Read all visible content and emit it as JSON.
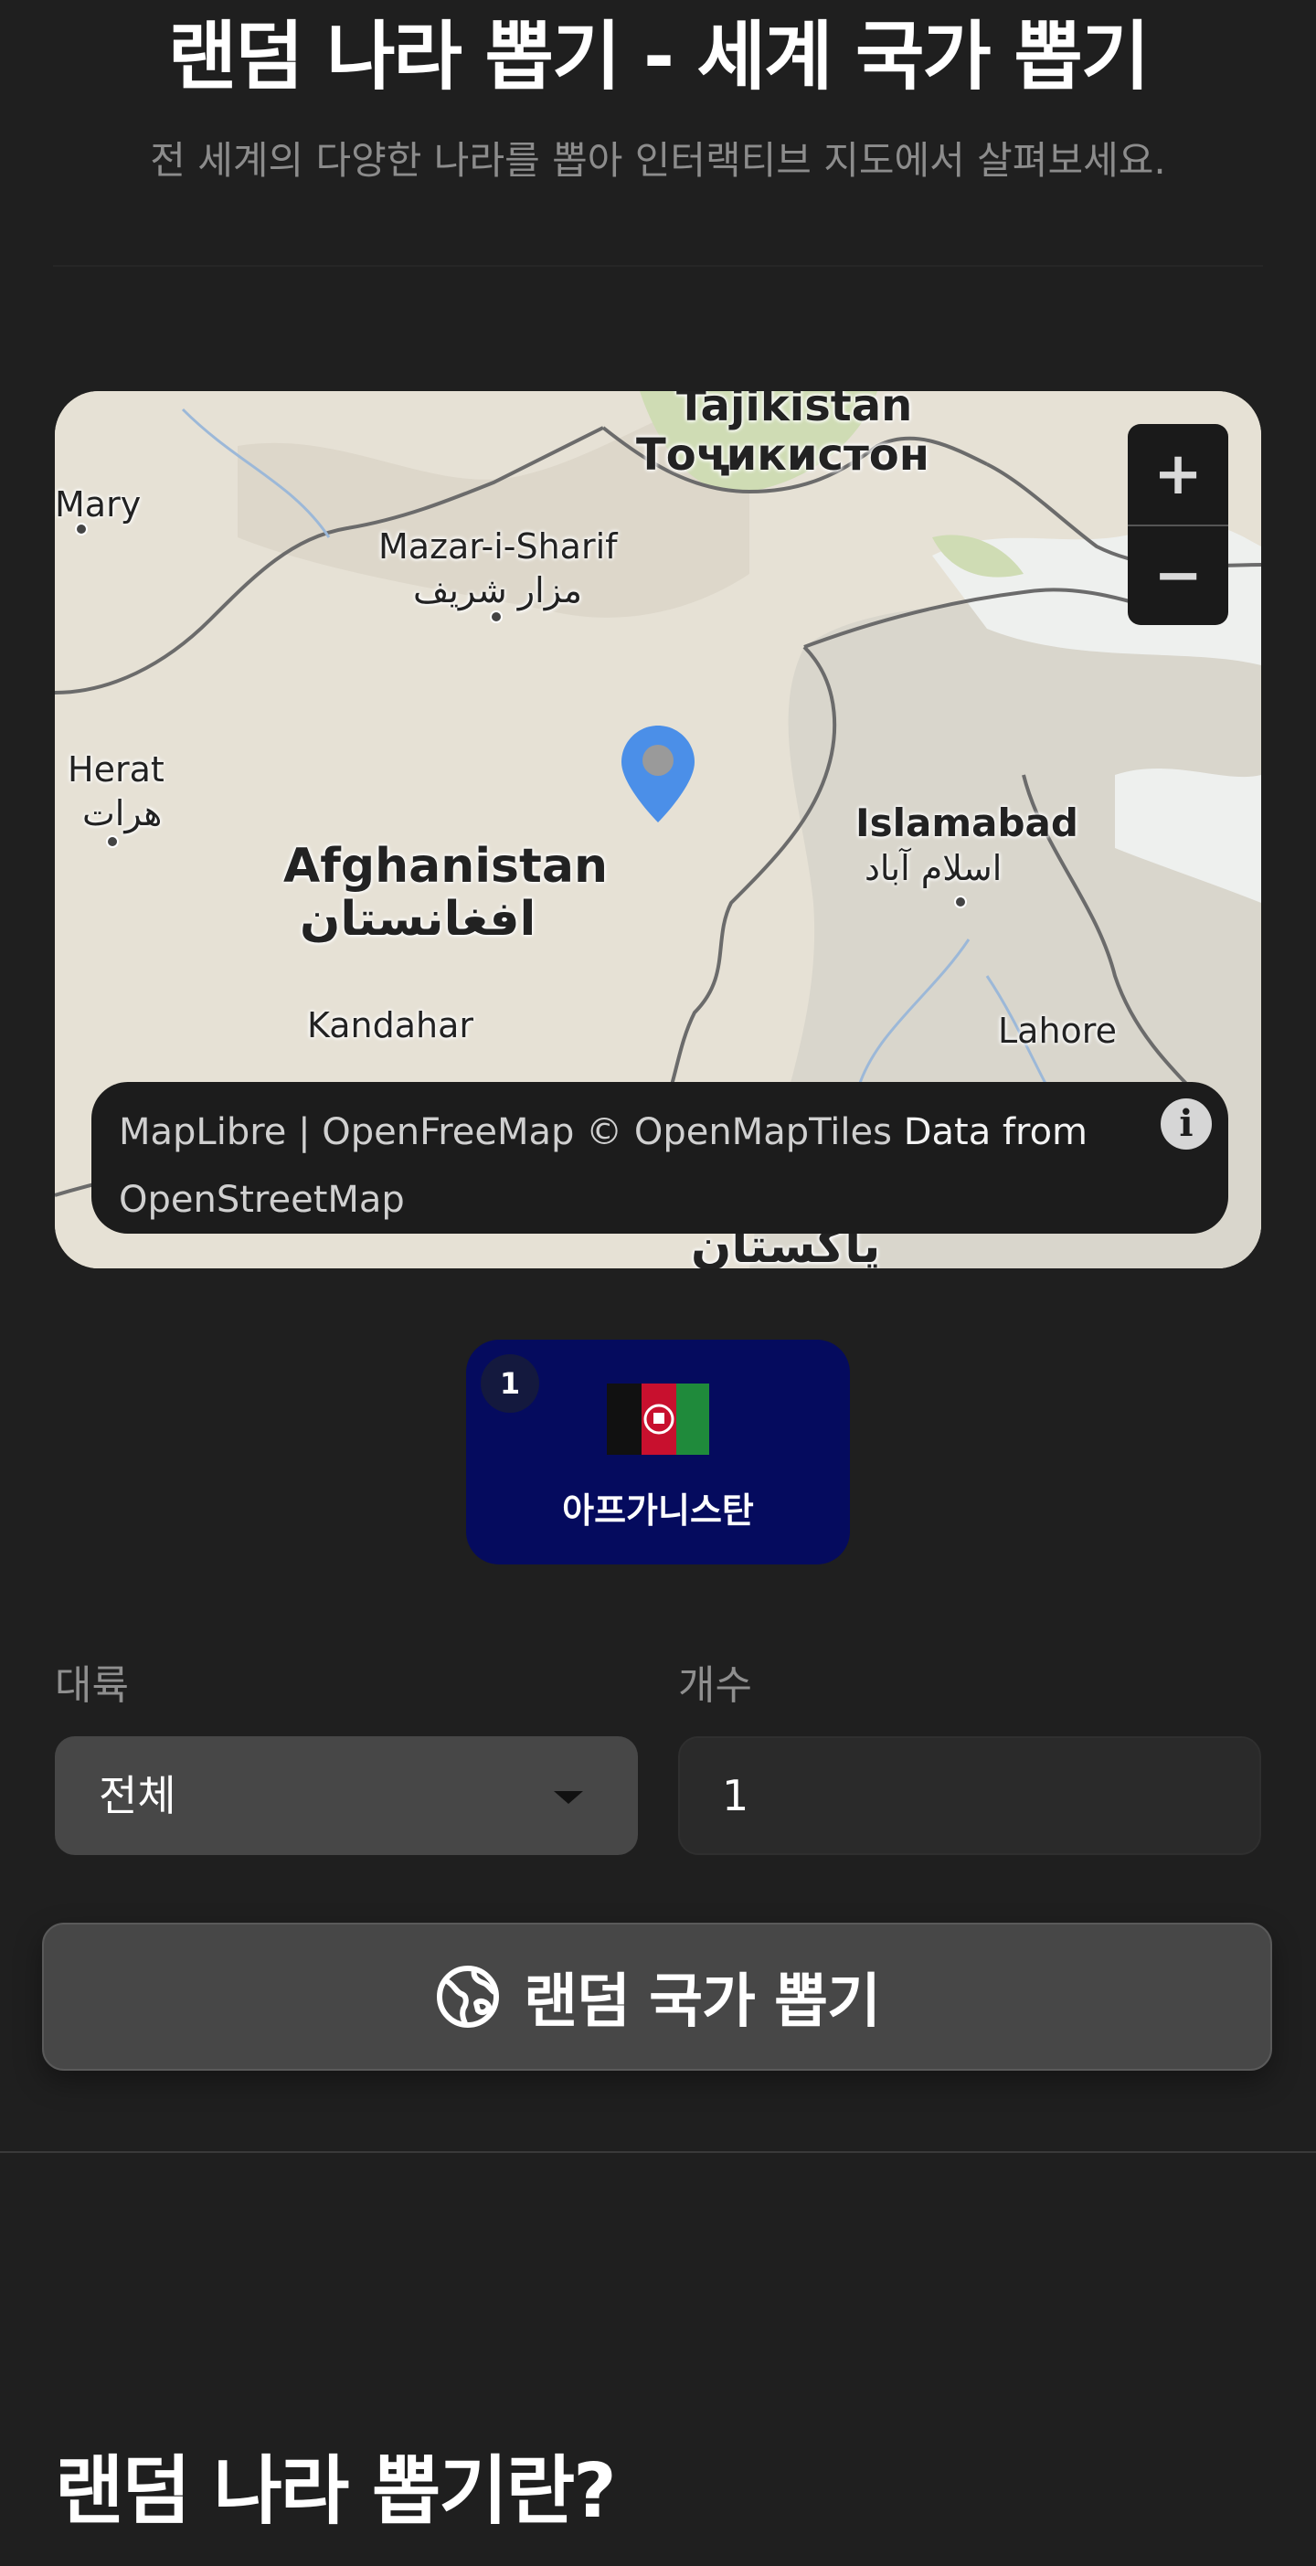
{
  "header": {
    "title": "랜덤 나라 뽑기 - 세계 국가 뽑기",
    "subtitle": "전 세계의 다양한 나라를 뽑아 인터랙티브 지도에서 살펴보세요."
  },
  "map": {
    "labels": {
      "tajikistan": "Tajikistan",
      "tajikistan_native": "Тоҷикистон",
      "mary": "Mary",
      "mazar": "Mazar-i-Sharif",
      "mazar_native": "مزار شریف",
      "herat": "Herat",
      "herat_native": "هرات",
      "afghanistan": "Afghanistan",
      "afghanistan_native": "افغانستان",
      "islamabad": "Islamabad",
      "islamabad_native": "اسلام آباد",
      "kandahar": "Kandahar",
      "lahore": "Lahore",
      "pakistan_native": "پاکستان"
    },
    "zoom_in": "+",
    "zoom_out": "−",
    "attribution_prefix": "MapLibre | OpenFreeMap © OpenMapTiles",
    "attribution_suffix": "Data from",
    "attribution_line2": "OpenStreetMap",
    "info_icon": "i"
  },
  "result": {
    "index": "1",
    "flag": "flag-afghanistan-icon",
    "country": "아프가니스탄",
    "card_color": "#050b5e"
  },
  "controls": {
    "continent_label": "대륙",
    "continent_value": "전체",
    "count_label": "개수",
    "count_value": "1",
    "draw_button": "랜덤 국가 뽑기"
  },
  "section": {
    "heading": "랜덤 나라 뽑기란?"
  }
}
